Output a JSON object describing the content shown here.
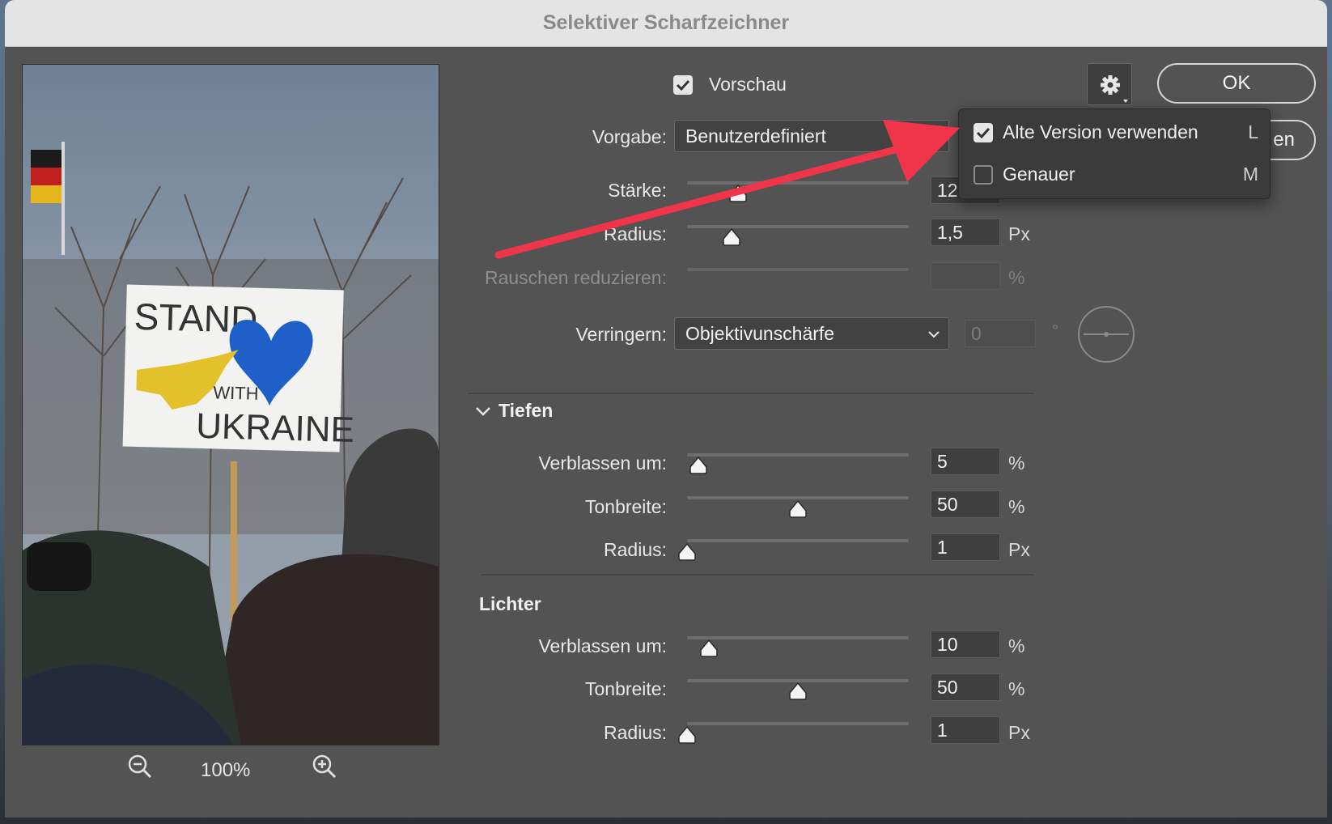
{
  "dialog": {
    "title": "Selektiver Scharfzeichner",
    "preview_checkbox_label": "Vorschau",
    "preview_checked": true,
    "ok_label": "OK",
    "cancel_label_partial": "en"
  },
  "zoom": {
    "level": "100%",
    "zoom_out_icon": "zoom-out-icon",
    "zoom_in_icon": "zoom-in-icon"
  },
  "preset": {
    "label": "Vorgabe:",
    "value": "Benutzerdefiniert"
  },
  "main": {
    "amount": {
      "label": "Stärke:",
      "value": "12",
      "fraction": 0.23
    },
    "radius": {
      "label": "Radius:",
      "value": "1,5",
      "unit": "Px",
      "fraction": 0.2
    },
    "noise": {
      "label": "Rauschen reduzieren:",
      "value": "",
      "unit": "%"
    }
  },
  "remove": {
    "label": "Verringern:",
    "value": "Objektivunschärfe",
    "angle_value": "0",
    "angle_unit": "°"
  },
  "shadows": {
    "title": "Tiefen",
    "fade": {
      "label": "Verblassen um:",
      "value": "5",
      "unit": "%",
      "fraction": 0.05
    },
    "tonal_width": {
      "label": "Tonbreite:",
      "value": "50",
      "unit": "%",
      "fraction": 0.5
    },
    "radius": {
      "label": "Radius:",
      "value": "1",
      "unit": "Px",
      "fraction": 0.0
    }
  },
  "highlights": {
    "title": "Lichter",
    "fade": {
      "label": "Verblassen um:",
      "value": "10",
      "unit": "%",
      "fraction": 0.1
    },
    "tonal_width": {
      "label": "Tonbreite:",
      "value": "50",
      "unit": "%",
      "fraction": 0.5
    },
    "radius": {
      "label": "Radius:",
      "value": "1",
      "unit": "Px",
      "fraction": 0.0
    }
  },
  "settings_menu": {
    "items": [
      {
        "label": "Alte Version verwenden",
        "key": "L",
        "checked": true
      },
      {
        "label": "Genauer",
        "key": "M",
        "checked": false
      }
    ]
  },
  "preview_image": {
    "sign_line1": "STAND",
    "sign_line2": "WITH",
    "sign_line3": "UKRAINE"
  },
  "annotation": {
    "arrow_color": "#f0344a"
  },
  "colors": {
    "dialog_bg": "#535353",
    "titlebar_bg": "#e4e4e4",
    "accent": "#e6e6e6"
  }
}
